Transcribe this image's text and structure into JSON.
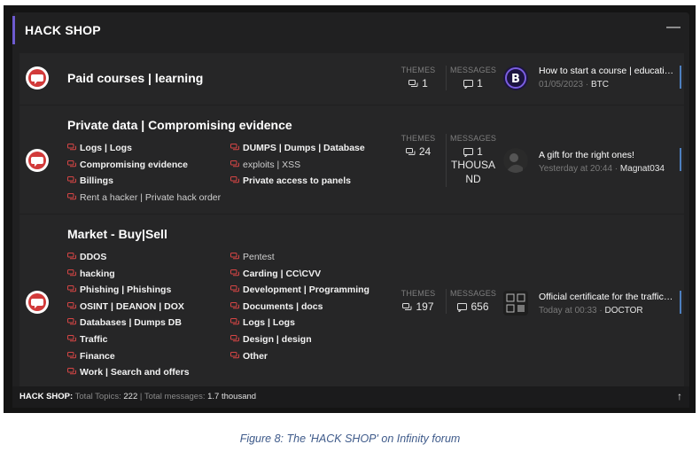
{
  "section": {
    "title": "HACK SHOP",
    "collapse_icon": "minus-icon"
  },
  "forums": [
    {
      "name": "Paid courses | learning",
      "themes_label": "THEMES",
      "themes": "1",
      "messages_label": "MESSAGES",
      "messages": "1",
      "last_title": "How to start a course | educati…",
      "last_date": "01/05/2023",
      "last_user": "BTC"
    },
    {
      "name": "Private data | Compromising evidence",
      "subforums": [
        {
          "label": "Logs | Logs",
          "bold": true
        },
        {
          "label": "DUMPS | Dumps | Database",
          "bold": true
        },
        {
          "label": "Compromising evidence",
          "bold": true
        },
        {
          "label": "exploits | XSS",
          "bold": false
        },
        {
          "label": "Billings",
          "bold": true
        },
        {
          "label": "Private access to panels",
          "bold": true
        },
        {
          "label": "Rent a hacker | Private hack order",
          "bold": false
        }
      ],
      "themes_label": "THEMES",
      "themes": "24",
      "messages_label": "MESSAGES",
      "messages_line1": "1",
      "messages_line2": "THOUSA",
      "messages_line3": "ND",
      "last_title": "A gift for the right ones!",
      "last_date": "Yesterday at 20:44",
      "last_user": "Magnat034"
    },
    {
      "name": "Market - Buy|Sell",
      "subforums": [
        {
          "label": "DDOS",
          "bold": true
        },
        {
          "label": "Pentest",
          "bold": false
        },
        {
          "label": "hacking",
          "bold": true
        },
        {
          "label": "Carding | CC\\CVV",
          "bold": true
        },
        {
          "label": "Phishing | Phishings",
          "bold": true
        },
        {
          "label": "Development | Programming",
          "bold": true
        },
        {
          "label": "OSINT | DEANON | DOX",
          "bold": true
        },
        {
          "label": "Documents | docs",
          "bold": true
        },
        {
          "label": "Databases | Dumps DB",
          "bold": true
        },
        {
          "label": "Logs | Logs",
          "bold": true
        },
        {
          "label": "Traffic",
          "bold": true
        },
        {
          "label": "Design | design",
          "bold": true
        },
        {
          "label": "Finance",
          "bold": true
        },
        {
          "label": "Other",
          "bold": true
        },
        {
          "label": "Work | Search and offers",
          "bold": true
        }
      ],
      "themes_label": "THEMES",
      "themes": "197",
      "messages_label": "MESSAGES",
      "messages": "656",
      "last_title": "Official certificate for the traffic…",
      "last_date": "Today at 00:33",
      "last_user": "DOCTOR"
    }
  ],
  "footer": {
    "label": "HACK SHOP:",
    "topics_label": "Total Topics:",
    "topics": "222",
    "sep": "|",
    "messages_label": "Total messages:",
    "messages": "1.7 thousand",
    "up_icon": "arrow-up-icon"
  },
  "caption": "Figure 8: The 'HACK SHOP' on Infinity forum",
  "colors": {
    "accent": "#6d5bd0",
    "bubble": "#d64545",
    "bar": "#4d7fbf"
  }
}
